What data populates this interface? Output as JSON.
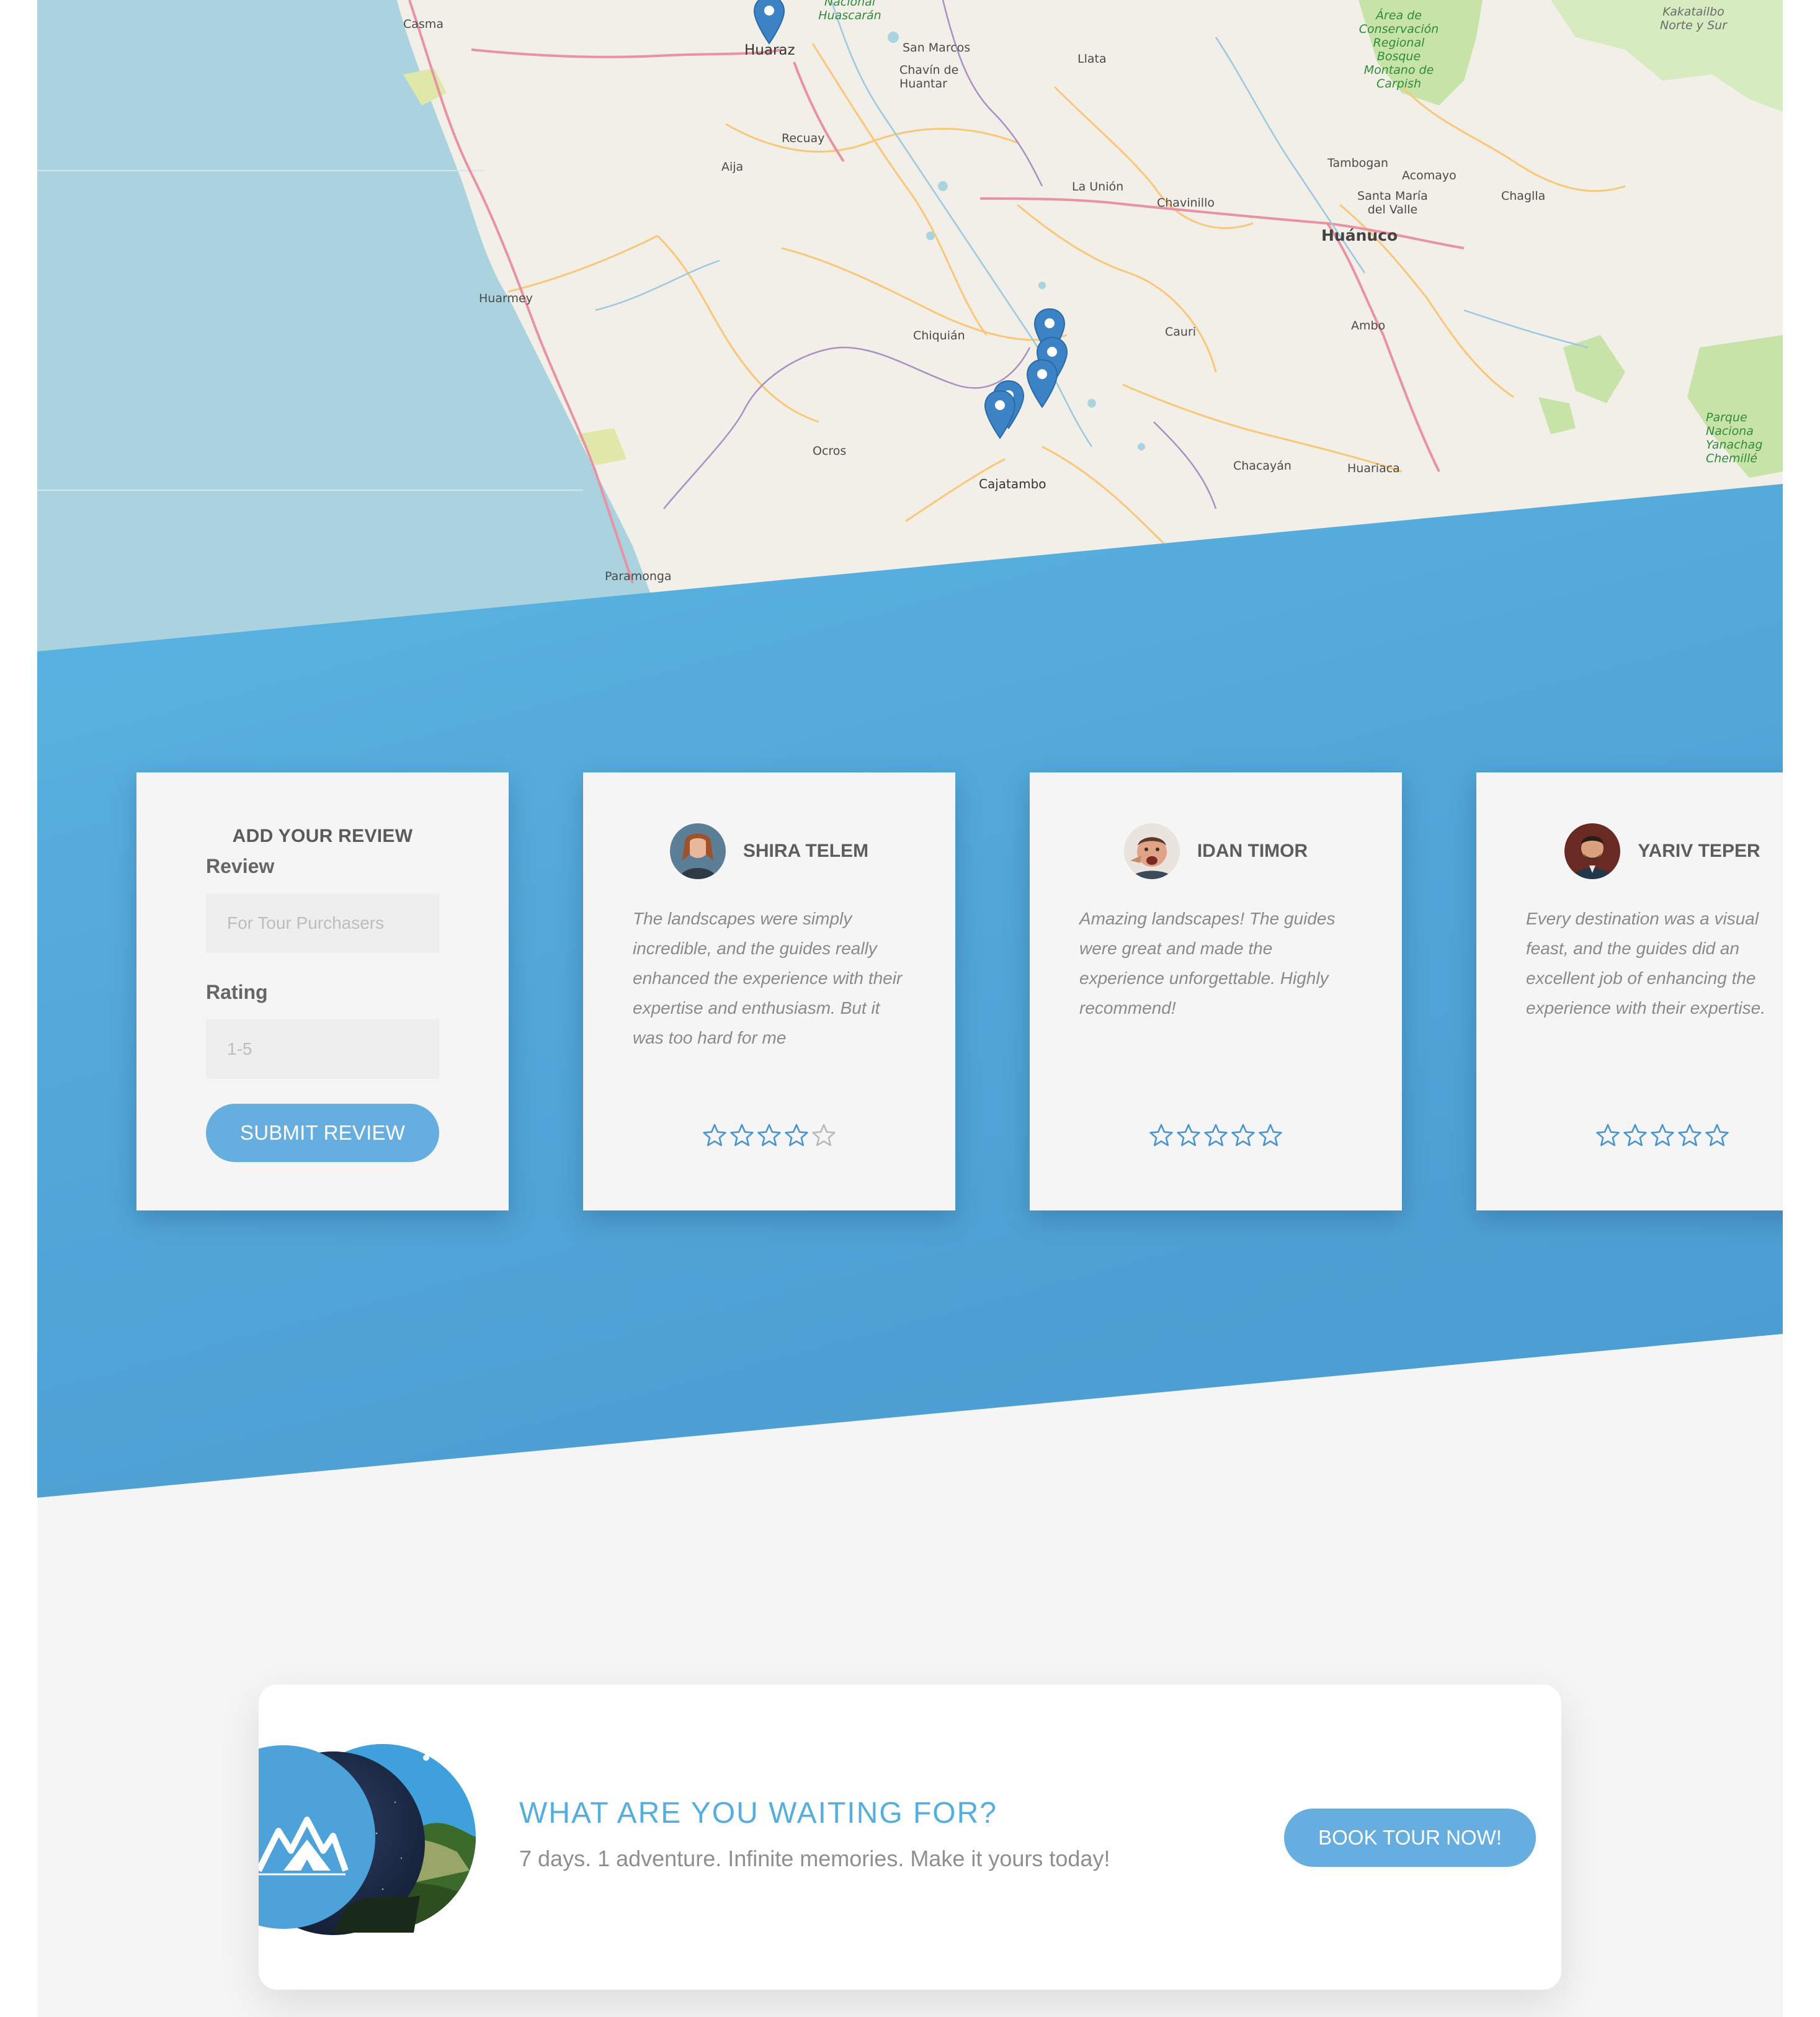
{
  "map": {
    "labels": {
      "casma": "Casma",
      "huaraz": "Huaraz",
      "parque_huascaran": "Nacional Huascarán",
      "san_marcos": "San Marcos",
      "chavin": "Chavín de Huantar",
      "llata": "Llata",
      "area_conservacion": "Área de Conservación Regional Bosque Montano de Carpish",
      "kakatailbo": "Kakatailbo Norte y Sur",
      "recuay": "Recuay",
      "aija": "Aija",
      "la_union": "La Unión",
      "chavinillo": "Chavinillo",
      "tambogan": "Tambogan",
      "acomayo": "Acomayo",
      "santa_maria": "Santa María del Valle",
      "chaglla": "Chaglla",
      "huanuco": "Huánuco",
      "huarmey": "Huarmey",
      "chiquian": "Chiquián",
      "cauri": "Cauri",
      "ambo": "Ambo",
      "parque_yanachaga": "Parque Naciona Yanachag Chemillé",
      "ocros": "Ocros",
      "cajatambo": "Cajatambo",
      "chacayan": "Chacayán",
      "huariaca": "Huariaca",
      "paramonga": "Paramonga"
    },
    "colors": {
      "land": "#f2efe9",
      "water": "#aad3df",
      "park": "#c8e3a8",
      "road_major": "#e892a2",
      "road_minor": "#f9c777"
    }
  },
  "review_form": {
    "title": "ADD YOUR REVIEW",
    "review_label": "Review",
    "review_placeholder": "For Tour Purchasers",
    "rating_label": "Rating",
    "rating_placeholder": "1-5",
    "submit_label": "SUBMIT REVIEW"
  },
  "reviews": [
    {
      "name": "SHIRA TELEM",
      "text": "The landscapes were simply incredible, and the guides really enhanced the experience with their expertise and enthusiasm. But it was too hard for me",
      "rating": 4,
      "max_rating": 5
    },
    {
      "name": "IDAN TIMOR",
      "text": "Amazing landscapes! The guides were great and made the experience unforgettable. Highly recommend!",
      "rating": 5,
      "max_rating": 5
    },
    {
      "name": "YARIV TEPER",
      "text": "Every destination was a visual feast, and the guides did an excellent job of enhancing the experience with their expertise.",
      "rating": 5,
      "max_rating": 5
    }
  ],
  "cta": {
    "title": "WHAT ARE YOU WAITING FOR?",
    "subtitle": "7 days. 1 adventure. Infinite memories. Make it yours today!",
    "button_label": "BOOK TOUR NOW!"
  },
  "colors": {
    "accent": "#67aee0",
    "band_blue": "#52a6d8",
    "star": "#4a95cf"
  }
}
